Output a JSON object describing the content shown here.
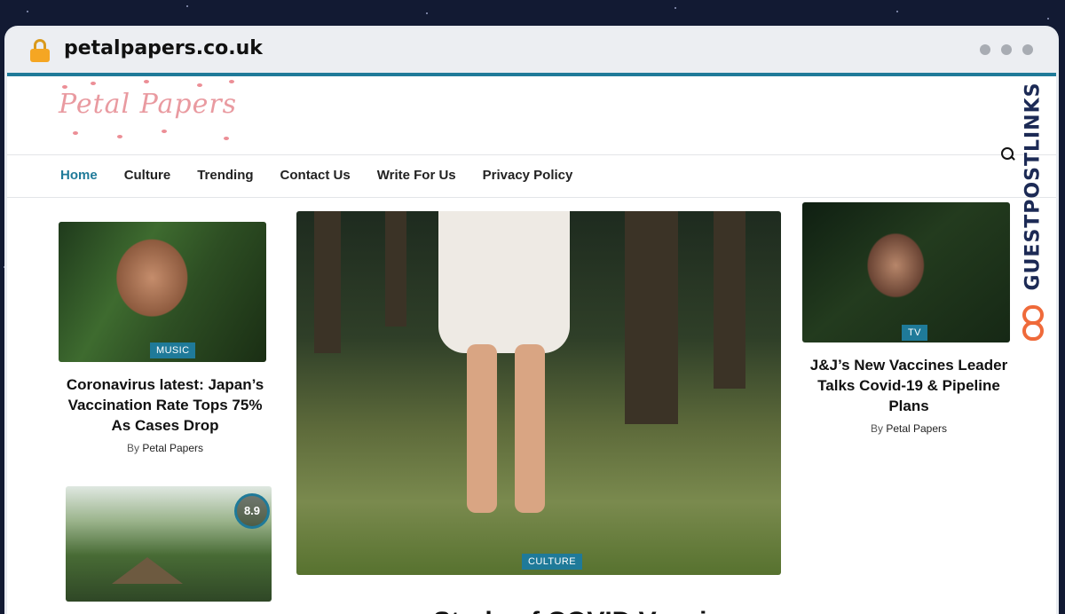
{
  "browser": {
    "url": "petalpapers.co.uk"
  },
  "site": {
    "logo_text": "Petal Papers"
  },
  "nav": {
    "items": [
      {
        "label": "Home",
        "active": true
      },
      {
        "label": "Culture"
      },
      {
        "label": "Trending"
      },
      {
        "label": "Contact Us"
      },
      {
        "label": "Write For Us"
      },
      {
        "label": "Privacy Policy"
      }
    ]
  },
  "watermark": {
    "text": "GUESTPOSTLINKS"
  },
  "articles": [
    {
      "category": "MUSIC",
      "title": "Coronavirus latest: Japan’s Vaccination Rate Tops 75% As Cases Drop",
      "byline_prefix": "By",
      "author": "Petal Papers"
    },
    {
      "score": "8.9"
    },
    {
      "category": "CULTURE",
      "title_partial": "Study of COVID Vaccine"
    },
    {
      "category": "TV",
      "title": "J&J’s New Vaccines Leader Talks Covid-19 & Pipeline Plans",
      "byline_prefix": "By",
      "author": "Petal Papers"
    }
  ],
  "colors": {
    "accent": "#1f7a99",
    "logo_pink": "#e99aa0",
    "watermark_navy": "#1c2a55",
    "watermark_orange": "#ef6a3a"
  }
}
